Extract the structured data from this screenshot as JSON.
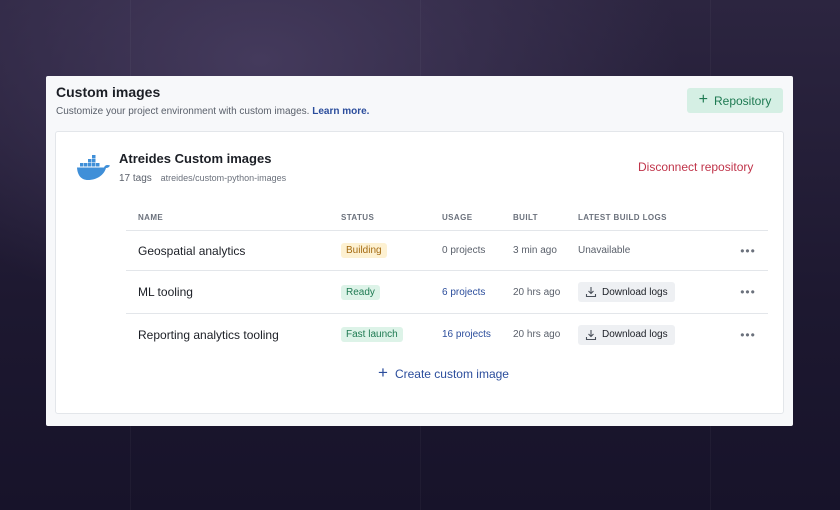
{
  "page": {
    "title": "Custom images",
    "subtitle": "Customize your project environment with custom images.",
    "learn_more": "Learn more.",
    "add_repository_label": "Repository"
  },
  "repository": {
    "icon": "docker-whale-icon",
    "name": "Atreides Custom images",
    "tags": "17 tags",
    "path": "atreides/custom-python-images",
    "disconnect_label": "Disconnect repository"
  },
  "table": {
    "columns": [
      "NAME",
      "STATUS",
      "USAGE",
      "BUILT",
      "LATEST BUILD LOGS"
    ],
    "rows": [
      {
        "name": "Geospatial analytics",
        "status": "Building",
        "usage": "0 projects",
        "built": "3 min ago",
        "logs": "Unavailable"
      },
      {
        "name": "ML tooling",
        "status": "Ready",
        "usage": "6 projects",
        "built": "20 hrs ago",
        "logs": "Download logs"
      },
      {
        "name": "Reporting analytics tooling",
        "status": "Fast launch",
        "usage": "16 projects",
        "built": "20 hrs ago",
        "logs": "Download logs"
      }
    ],
    "more_label": "•••"
  },
  "create_label": "Create custom image",
  "colors": {
    "accent_green": "#1e7a52",
    "link_blue": "#2b4d9c",
    "danger_red": "#c0344a",
    "building_amber": "#a46a10"
  }
}
